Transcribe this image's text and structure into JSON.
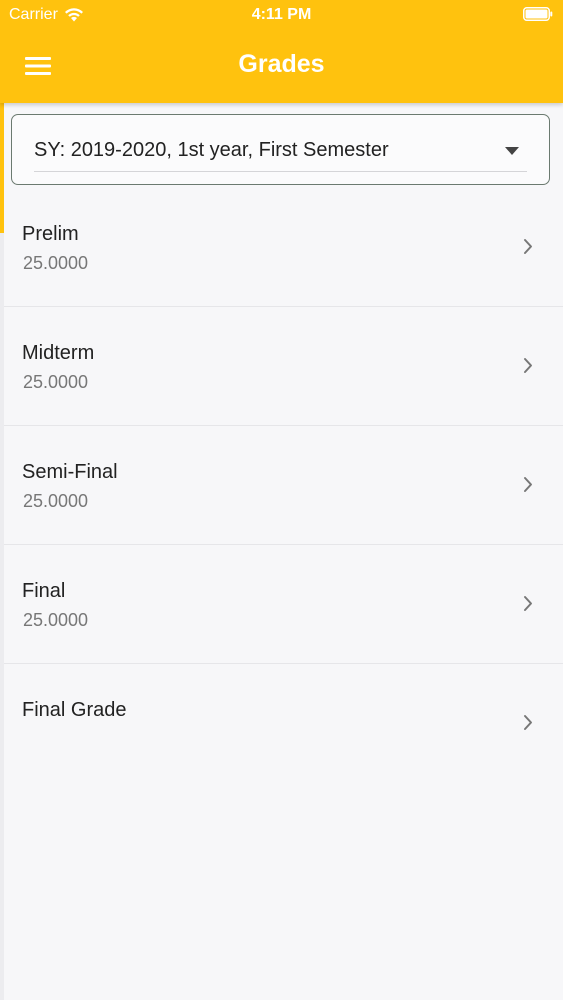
{
  "status_bar": {
    "carrier": "Carrier",
    "time": "4:11 PM",
    "icons": [
      "wifi-icon",
      "battery-icon"
    ]
  },
  "header": {
    "title": "Grades",
    "menu_icon": "menu-icon",
    "background_color": "#ffc20e"
  },
  "semester_select": {
    "selected": "SY: 2019-2020, 1st year, First Semester",
    "icon": "dropdown-arrow-icon"
  },
  "grades": [
    {
      "label": "Prelim",
      "value": "25.0000"
    },
    {
      "label": "Midterm",
      "value": "25.0000"
    },
    {
      "label": "Semi-Final",
      "value": "25.0000"
    },
    {
      "label": "Final",
      "value": "25.0000"
    },
    {
      "label": "Final Grade",
      "value": ""
    }
  ],
  "colors": {
    "accent": "#ffc20e",
    "background": "#f7f7f9",
    "secondary_text": "#777777"
  }
}
